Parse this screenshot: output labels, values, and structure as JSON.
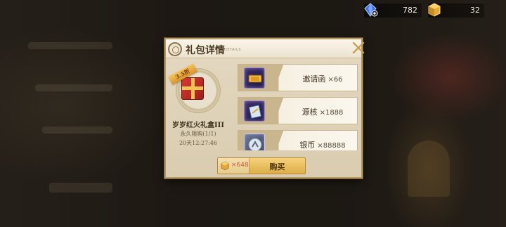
{
  "resources": [
    {
      "icon": "blue-crystal-icon",
      "value": "782"
    },
    {
      "icon": "gold-cube-icon",
      "value": "32"
    }
  ],
  "dialog": {
    "title": "礼包详情",
    "subtitle": "DETAILS",
    "close_icon": "close-x-icon"
  },
  "pack": {
    "ribbon": "3.5折",
    "name": "岁岁红火礼盒III",
    "limit": "永久限购(1/1)",
    "time_left": "20天12:27:46"
  },
  "items": [
    {
      "icon": "invitation-ticket-icon",
      "name": "邀请函",
      "qty": "×66"
    },
    {
      "icon": "source-core-icon",
      "name": "源核",
      "qty": "×1888"
    },
    {
      "icon": "silver-coin-icon",
      "name": "银币",
      "qty": "×88888"
    }
  ],
  "buy": {
    "currency_icon": "gold-cube-icon",
    "price": "×648",
    "label": "购买"
  },
  "colors": {
    "accent_gold": "#dcae48",
    "price_red": "#c85a3a",
    "panel_bg": "#e9e0cc"
  }
}
